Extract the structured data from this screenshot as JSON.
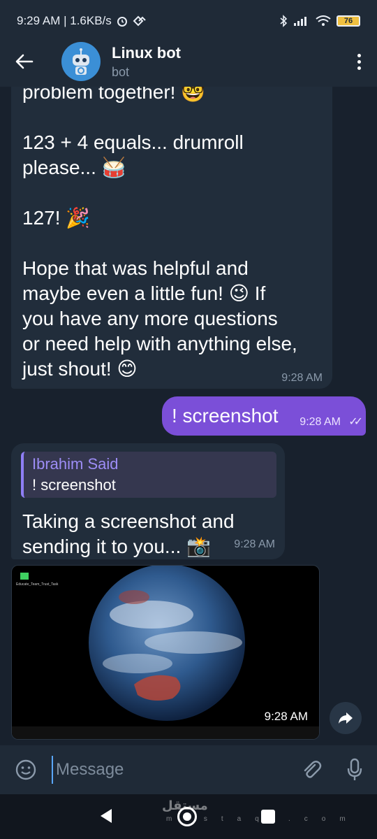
{
  "status_bar": {
    "time_speed": "9:29 AM | 1.6KB/s",
    "battery": "76"
  },
  "header": {
    "title": "Linux bot",
    "subtitle": "bot"
  },
  "messages": {
    "bot_1": {
      "p1": "problem together! 🤓",
      "p2a": "123 + 4 equals... drumroll",
      "p2b": "please... 🥁",
      "p3": "127! 🎉",
      "p4a": "Hope that was helpful and",
      "p4b": "maybe even a little fun! 😉 If",
      "p4c": "you have any more questions",
      "p4d": "or need help with anything else,",
      "p4e": "just shout! 😊",
      "time": "9:28 AM"
    },
    "user_1": {
      "text": "! screenshot",
      "time": "9:28 AM",
      "check": "✓✓"
    },
    "bot_2": {
      "reply_name": "Ibrahim Said",
      "reply_text": "! screenshot",
      "text": "Taking a screenshot and sending it to you... 📸",
      "time": "9:28 AM"
    },
    "photo": {
      "time": "9:28 AM",
      "desktop_icon_label": "Educate_Team_Trust_Task"
    }
  },
  "composer": {
    "placeholder": "Message"
  },
  "watermark": {
    "arabic": "مستقل",
    "latin": "mostaql.com"
  }
}
